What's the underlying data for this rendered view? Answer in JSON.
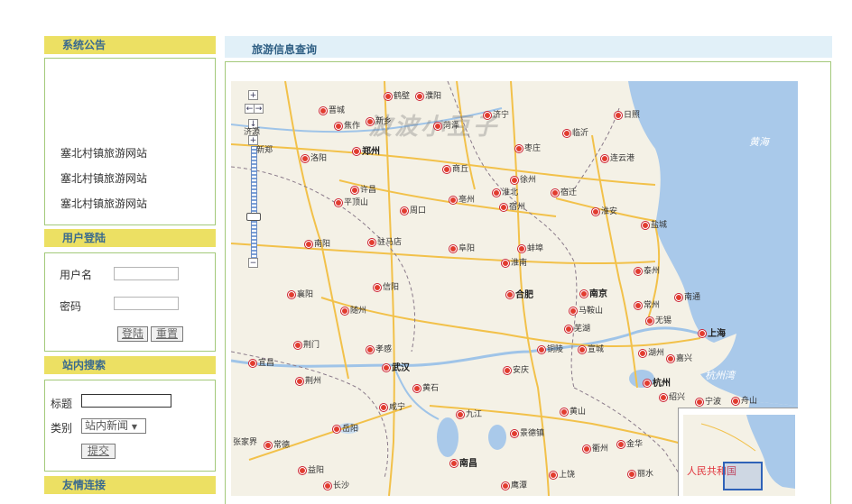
{
  "sidebar": {
    "notice": {
      "title": "系统公告",
      "items": [
        "塞北村镇旅游网站",
        "塞北村镇旅游网站",
        "塞北村镇旅游网站"
      ]
    },
    "login": {
      "title": "用户登陆",
      "username_label": "用户名",
      "password_label": "密码",
      "login_button": "登陆",
      "reset_button": "重置"
    },
    "search": {
      "title": "站内搜索",
      "title_label": "标题",
      "category_label": "类别",
      "category_selected": "站内新闻",
      "submit_button": "提交"
    },
    "links": {
      "title": "友情连接"
    }
  },
  "main": {
    "title": "旅游信息查询",
    "map": {
      "watermark": "波波小豆子",
      "sea_labels": [
        "黄海",
        "杭州湾"
      ],
      "overview_label": "人民共和国",
      "cities": [
        "鹤壁",
        "濮阳",
        "晋城",
        "焦作",
        "新乡",
        "菏泽",
        "济宁",
        "日照",
        "临沂",
        "枣庄",
        "郑州",
        "洛阳",
        "商丘",
        "徐州",
        "连云港",
        "许昌",
        "淮北",
        "宿迁",
        "平顶山",
        "周口",
        "亳州",
        "宿州",
        "淮安",
        "盐城",
        "南阳",
        "驻马店",
        "阜阳",
        "蚌埠",
        "淮南",
        "泰州",
        "信阳",
        "襄阳",
        "随州",
        "合肥",
        "南京",
        "常州",
        "南通",
        "马鞍山",
        "无锡",
        "芜湖",
        "上海",
        "荆门",
        "孝感",
        "铜陵",
        "宣城",
        "湖州",
        "宜昌",
        "武汉",
        "荆州",
        "安庆",
        "嘉兴",
        "杭州",
        "黄石",
        "绍兴",
        "宁波",
        "舟山",
        "咸宁",
        "九江",
        "黄山",
        "岳阳",
        "景德镇",
        "衢州",
        "金华",
        "常德",
        "南昌",
        "益阳",
        "长沙",
        "上饶",
        "丽水",
        "鹰潭",
        "张家界",
        "济源",
        "新郑"
      ]
    }
  },
  "colors": {
    "sidebar_header_bg": "#ece063",
    "sidebar_header_text": "#3a6a8e",
    "box_border": "#a3c97a",
    "main_header_bg": "#e1f0f8",
    "sea": "#a9c9ea",
    "land": "#f4f1e6"
  }
}
